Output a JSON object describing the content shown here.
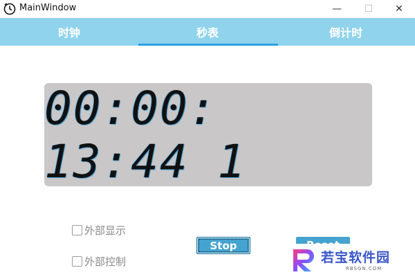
{
  "window": {
    "title": "MainWindow",
    "minimize_glyph": "—",
    "maximize_glyph": "☐",
    "close_glyph": "✕"
  },
  "tabs": [
    {
      "label": "时钟",
      "active": false
    },
    {
      "label": "秒表",
      "active": true
    },
    {
      "label": "倒计时",
      "active": false
    }
  ],
  "stopwatch": {
    "display": "00:00: 13:44 1"
  },
  "options": [
    {
      "label": "外部显示",
      "checked": false
    },
    {
      "label": "外部控制",
      "checked": false
    }
  ],
  "buttons": {
    "stop_label": "Stop",
    "reset_label": "Reset"
  },
  "watermark": {
    "text": "若宝软件园",
    "subtext": "RBSGN.COM"
  },
  "colors": {
    "tab_bar": "#8fd3ec",
    "tab_active_underline": "#2d9fe5",
    "display_bg": "#c9c7c7",
    "button_bg": "#45a3cf"
  },
  "icons": {
    "app": "clock-icon",
    "minimize": "minimize-icon",
    "maximize": "maximize-icon",
    "close": "close-icon",
    "checkbox": "checkbox-icon",
    "watermark_logo": "r-logo-icon"
  }
}
